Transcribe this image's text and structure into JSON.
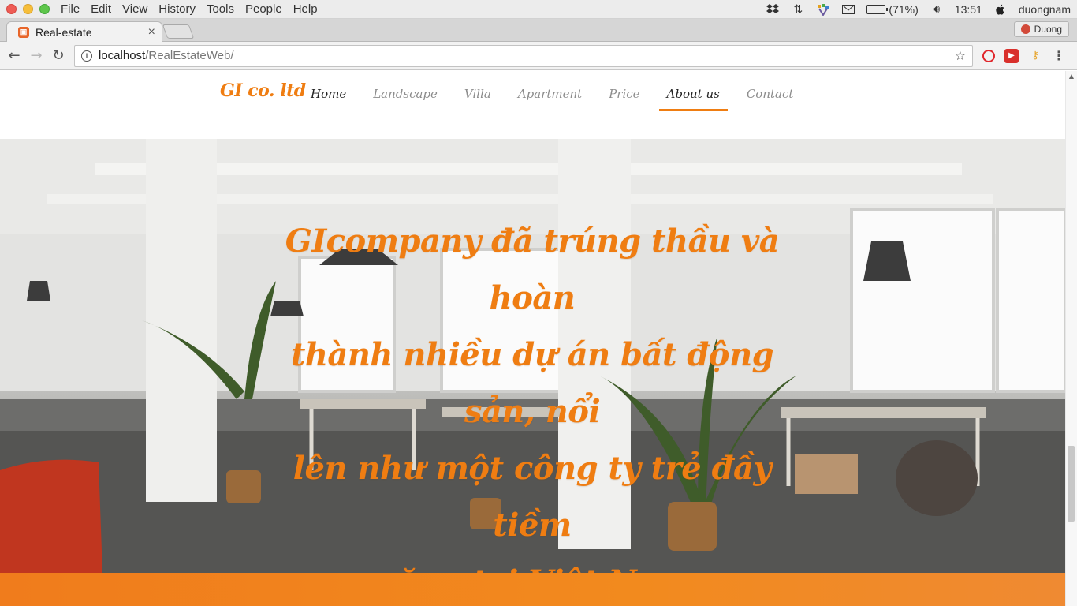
{
  "os": {
    "menu": [
      "File",
      "Edit",
      "View",
      "History",
      "Tools",
      "People",
      "Help"
    ],
    "battery_text": "(71%)",
    "battery_level": 0.71,
    "clock": "13:51",
    "user": "duongnam",
    "tray_icons": [
      "dropbox-icon",
      "network-arrows-icon",
      "vm-icon",
      "mail-icon",
      "battery-icon",
      "volume-icon",
      "apple-icon"
    ]
  },
  "browser": {
    "tab_title": "Real-estate",
    "tab_close": "×",
    "profile_name": "Duong",
    "url_host": "localhost",
    "url_path": "/RealEstateWeb/",
    "back": "←",
    "forward": "→",
    "reload": "↻",
    "bookmark_star": "☆"
  },
  "site": {
    "brand": "GI co. ltd",
    "nav": [
      {
        "label": "Home"
      },
      {
        "label": "Landscape"
      },
      {
        "label": "Villa"
      },
      {
        "label": "Apartment"
      },
      {
        "label": "Price"
      },
      {
        "label": "About us"
      },
      {
        "label": "Contact"
      }
    ],
    "active_nav": "About us",
    "hero_lines": [
      "GIcompany đã trúng thầu và hoàn",
      "thành nhiều dự án bất động sản, nổi",
      "lên như một công ty trẻ đầy tiềm",
      "năng tại Việt Nam"
    ],
    "accent_color": "#ef7d12"
  }
}
